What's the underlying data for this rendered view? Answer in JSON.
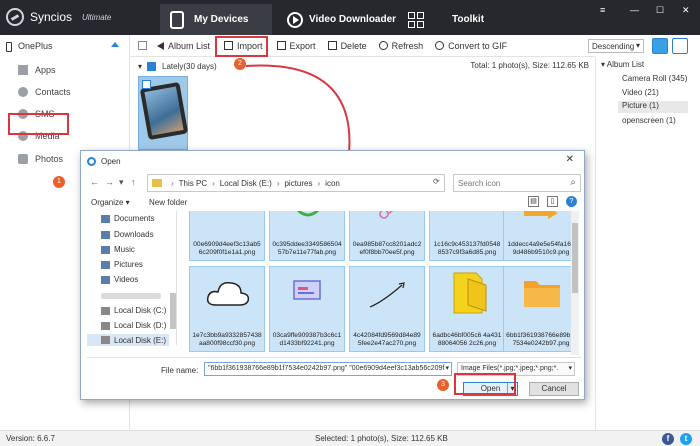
{
  "app": {
    "brand": "Syncios",
    "edition": "Ultimate",
    "nav": [
      {
        "label": "My Devices"
      },
      {
        "label": "Video Downloader"
      },
      {
        "label": "Toolkit"
      }
    ],
    "window_buttons": [
      "≡",
      "—",
      "☐",
      "✕"
    ]
  },
  "sidebar": {
    "device": "OnePlus",
    "items": [
      {
        "label": "Apps"
      },
      {
        "label": "Contacts"
      },
      {
        "label": "SMS"
      },
      {
        "label": "Media"
      },
      {
        "label": "Photos"
      }
    ]
  },
  "toolbar": {
    "album_list": "Album List",
    "import": "Import",
    "export": "Export",
    "delete": "Delete",
    "refresh": "Refresh",
    "convert_gif": "Convert to GIF",
    "sort": "Descending"
  },
  "subbar": {
    "group": "Lately(30 days)",
    "summary": "Total: 1 photo(s), Size: 112.65 KB"
  },
  "album_panel": {
    "title": "Album List",
    "items": [
      {
        "label": "Camera Roll (345)"
      },
      {
        "label": "Video (21)"
      },
      {
        "label": "Picture (1)"
      },
      {
        "label": "openscreen (1)"
      }
    ]
  },
  "status": {
    "version": "Version: 6.6.7",
    "selected": "Selected: 1 photo(s), Size: 112.65 KB"
  },
  "steps": {
    "one": "1",
    "two": "2",
    "three": "3"
  },
  "dialog": {
    "title": "Open",
    "path": [
      "This PC",
      "Local Disk (E:)",
      "pictures",
      "icon"
    ],
    "search_placeholder": "Search icon",
    "organize": "Organize ▾",
    "new_folder": "New folder",
    "tree": [
      {
        "label": "Documents"
      },
      {
        "label": "Downloads"
      },
      {
        "label": "Music"
      },
      {
        "label": "Pictures"
      },
      {
        "label": "Videos"
      },
      {
        "label": "Local Disk (C:)"
      },
      {
        "label": "Local Disk (D:)"
      },
      {
        "label": "Local Disk (E:)"
      }
    ],
    "files": [
      {
        "name": "00e6909d4eef3c13ab56c209f0f1e1a1.png"
      },
      {
        "name": "0c395ddee334958650457b7e11e77fab.png"
      },
      {
        "name": "0ea985b87cc8201adc2ef0f8bb70ee5f.png"
      },
      {
        "name": "1c16c9c453137fd05488537c9f3a6d85.png"
      },
      {
        "name": "1ddecc4a9e5e54fa16d9d486b9510c9.png"
      },
      {
        "name": "1e7c3bb9a9332857438aa800f98ccf30.png"
      },
      {
        "name": "03ca9ffe909387b3c6c1d1433bf92241.png"
      },
      {
        "name": "4c42084fd9569d84e895fee2e47ac270.png"
      },
      {
        "name": "6adbc46bf005c6 4a43188064056 2c26.png"
      },
      {
        "name": "6bb1f361938766e89b1f7534e0242b97.png"
      }
    ],
    "filename_label": "File name:",
    "filename_value": "\"6bb1f361938766e89b1f7534e0242b97.png\" \"00e6909d4eef3c13ab56c209f",
    "filetype": "Image Files(*.jpg;*.jpeg;*.png;*.",
    "open": "Open",
    "cancel": "Cancel"
  },
  "colors": {
    "topbar": "#26282d",
    "accent": "#2a83d2",
    "highlight": "#d9363e",
    "step_badge": "#e9602a"
  }
}
